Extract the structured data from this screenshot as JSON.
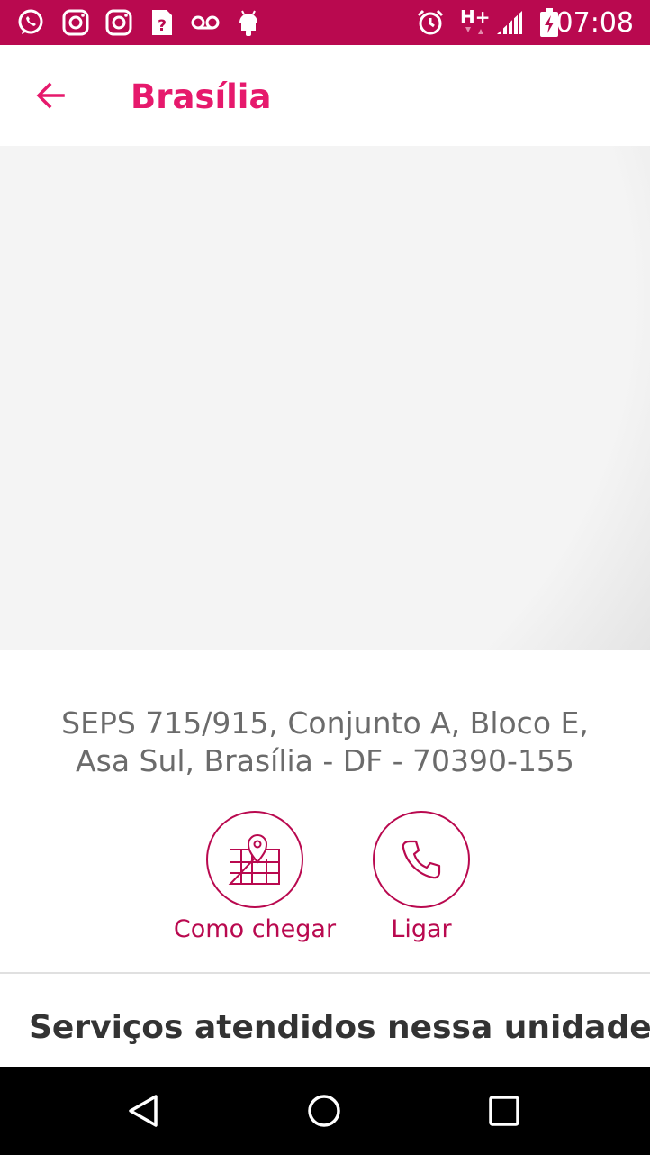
{
  "status_bar": {
    "time": "07:08",
    "network": "H+",
    "left_icons": [
      "whatsapp-icon",
      "instagram-icon",
      "instagram-icon",
      "sim-unknown-icon",
      "voicemail-icon",
      "android-icon"
    ],
    "right_icons": [
      "alarm-icon",
      "network-hplus-icon",
      "signal-icon",
      "battery-charging-icon"
    ],
    "background_color": "#b9094f"
  },
  "app_bar": {
    "title": "Brasília",
    "back_icon": "arrow-back-icon",
    "accent_color": "#e6196c"
  },
  "address": {
    "line1": "SEPS 715/915, Conjunto A, Bloco E,",
    "line2": "Asa Sul, Brasília - DF - 70390-155"
  },
  "actions": {
    "directions": {
      "label": "Como chegar",
      "icon": "map-pin-icon"
    },
    "call": {
      "label": "Ligar",
      "icon": "phone-icon"
    },
    "color": "#b9094f"
  },
  "services": {
    "title": "Serviços atendidos nessa unidade"
  },
  "nav_bar": {
    "buttons": [
      "back-triangle-icon",
      "home-circle-icon",
      "recents-square-icon"
    ]
  }
}
